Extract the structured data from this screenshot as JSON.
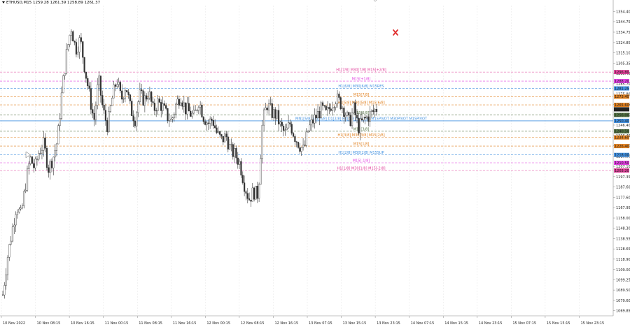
{
  "header": {
    "text": "ETHUSD,M15  1259.28 1261.39 1258.89 1261.37"
  },
  "colors": {
    "candle": "#333333",
    "magenta": "#e0409a",
    "pink": "#e040e0",
    "orange": "#e08020",
    "blue": "#4090e0",
    "green": "#507040",
    "black": "#222222",
    "red_cross": "#e03030"
  },
  "y_axis_ticks": [
    "1354.40",
    "1344.75",
    "1334.75",
    "1324.85",
    "1315.10",
    "1305.35",
    "1295.45",
    "1285.70",
    "1275.80",
    "1266.05",
    "1256.15",
    "1246.40",
    "1236.45",
    "1226.70",
    "1216.80",
    "1207.10",
    "1197.35",
    "1187.60",
    "1177.60",
    "1167.95",
    "1158.00",
    "1148.30",
    "1138.55",
    "1128.65",
    "1118.90",
    "1109.00",
    "1099.25",
    "1089.50",
    "1079.60",
    "1069.85"
  ],
  "x_axis_labels": [
    "10 Nov 2022",
    "10 Nov 08:15",
    "10 Nov 16:15",
    "11 Nov 00:15",
    "11 Nov 08:15",
    "11 Nov 16:15",
    "12 Nov 00:15",
    "12 Nov 08:15",
    "12 Nov 16:15",
    "13 Nov 07:15",
    "13 Nov 15:15",
    "13 Nov 23:15",
    "14 Nov 07:15",
    "14 Nov 15:15",
    "14 Nov 23:15",
    "15 Nov 07:15",
    "15 Nov 15:15",
    "15 Nov 23:15"
  ],
  "levels": [
    {
      "label": "H1[7/8] M30[7/8] M15[+2/8]",
      "color": "#e0409a",
      "price": 1296.8,
      "badge": "1296.80"
    },
    {
      "label": "M15[+1/8]",
      "color": "#e040e0",
      "price": 1288.2,
      "badge": "1288.20"
    },
    {
      "label": "H1[6/8] M30[6/8] M15RES",
      "color": "#4090e0",
      "price": 1281.25,
      "badge": "1281.25"
    },
    {
      "label": "M15[7/8]",
      "color": "#e08020",
      "price": 1273.4,
      "badge": "1273.40"
    },
    {
      "label": "H1[5/8] M30[5/8] M15[6/8]",
      "color": "#e08020",
      "price": 1265.6,
      "badge": "1265.60"
    },
    {
      "label": "M15[5/8]",
      "color": "#507040",
      "price": 1256.0,
      "badge": "1256.00"
    },
    {
      "label": "MN1[5/8] W1[5/8] D1[2/8] H4[4/8] H1 M30 M15PIVOT M30PIVOT M15PIVOT",
      "color": "#4090e0",
      "price": 1250.4,
      "badge": "1250.40"
    },
    {
      "label": "M15[3/8]",
      "color": "#507040",
      "price": 1240.5,
      "badge": "1240.50"
    },
    {
      "label": "H1[3/8] M30[3/8] M15[2/8]",
      "color": "#e08020",
      "price": 1234.6,
      "badge": "1234.60"
    },
    {
      "label": "M15[1/8]",
      "color": "#e08020",
      "price": 1226.4,
      "badge": "1226.40"
    },
    {
      "label": "H1[2/8] M30[2/8] M15SUP",
      "color": "#4090e0",
      "price": 1218.0,
      "badge": "1218.00"
    },
    {
      "label": "M15[-1/8]",
      "color": "#e040e0",
      "price": 1210.5,
      "badge": "1210.50"
    },
    {
      "label": "H1[1/8] M30[1/8] M15[-2/8]",
      "color": "#e0409a",
      "price": 1203.2,
      "badge": "1203.20"
    }
  ],
  "current_price": {
    "value": 1261.37,
    "badge": "1261.37"
  },
  "price_path": [
    1085,
    1120,
    1145,
    1170,
    1160,
    1190,
    1215,
    1205,
    1222,
    1228,
    1205,
    1215,
    1232,
    1280,
    1315,
    1340,
    1318,
    1328,
    1300,
    1275,
    1250,
    1290,
    1260,
    1245,
    1272,
    1290,
    1270,
    1285,
    1262,
    1252,
    1275,
    1270,
    1278,
    1260,
    1268,
    1264,
    1255,
    1250,
    1266,
    1275,
    1262,
    1258,
    1254,
    1270,
    1255,
    1248,
    1252,
    1238,
    1232,
    1236,
    1222,
    1218,
    1210,
    1190,
    1176,
    1183,
    1180,
    1250,
    1266,
    1258,
    1256,
    1244,
    1238,
    1248,
    1236,
    1228,
    1222,
    1242,
    1250,
    1256,
    1262,
    1256,
    1266,
    1272,
    1268,
    1260,
    1248,
    1262,
    1244,
    1250,
    1254,
    1258,
    1262
  ],
  "chart_data": {
    "type": "line",
    "title": "ETHUSD,M15  1259.28 1261.39 1258.89 1261.37",
    "xlabel": "",
    "ylabel": "",
    "ylim": [
      1065,
      1360
    ],
    "grid": true
  }
}
